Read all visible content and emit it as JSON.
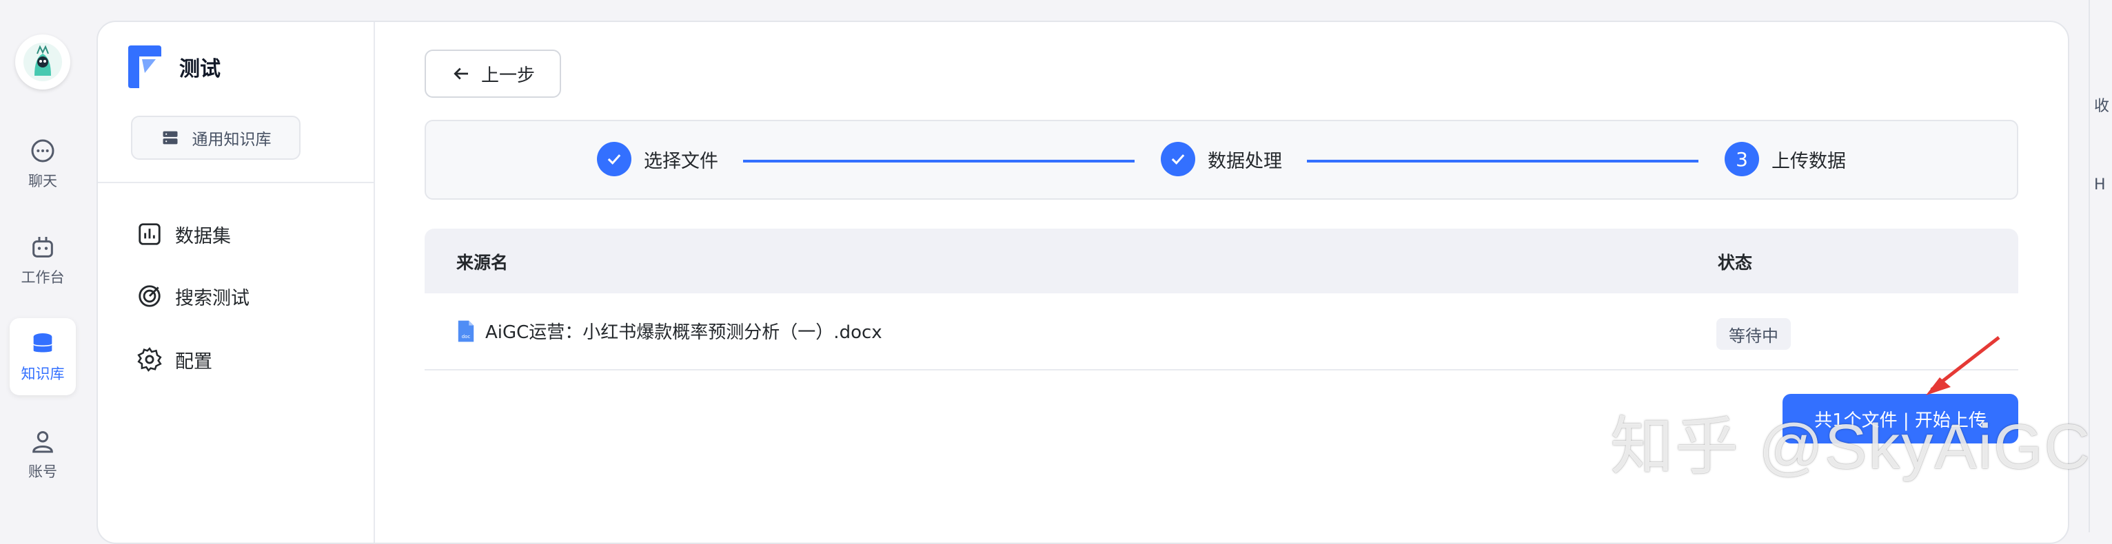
{
  "nav_rail": {
    "items": [
      {
        "label": "聊天",
        "icon": "chat-icon"
      },
      {
        "label": "工作台",
        "icon": "robot-icon"
      },
      {
        "label": "知识库",
        "icon": "database-icon",
        "active": true
      },
      {
        "label": "账号",
        "icon": "user-icon"
      }
    ],
    "accent_color": "#3370ff"
  },
  "sidebar": {
    "kb_name": "测试",
    "kb_type": "通用知识库",
    "menu": [
      {
        "label": "数据集",
        "icon": "chart-icon"
      },
      {
        "label": "搜索测试",
        "icon": "target-icon"
      },
      {
        "label": "配置",
        "icon": "gear-icon"
      }
    ]
  },
  "main": {
    "back_label": "上一步",
    "steps": [
      {
        "label": "选择文件",
        "state": "done"
      },
      {
        "label": "数据处理",
        "state": "done"
      },
      {
        "number": "3",
        "label": "上传数据",
        "state": "active"
      }
    ],
    "table": {
      "headers": [
        "来源名",
        "状态"
      ],
      "rows": [
        {
          "source": "AiGC运营：小红书爆款概率预测分析（一）.docx",
          "status": "等待中"
        }
      ]
    },
    "upload_button": "共1个文件 | 开始上传"
  },
  "watermark": "知乎 @SkyAiGC",
  "right_edge": {
    "text1": "收",
    "text2": "H"
  }
}
